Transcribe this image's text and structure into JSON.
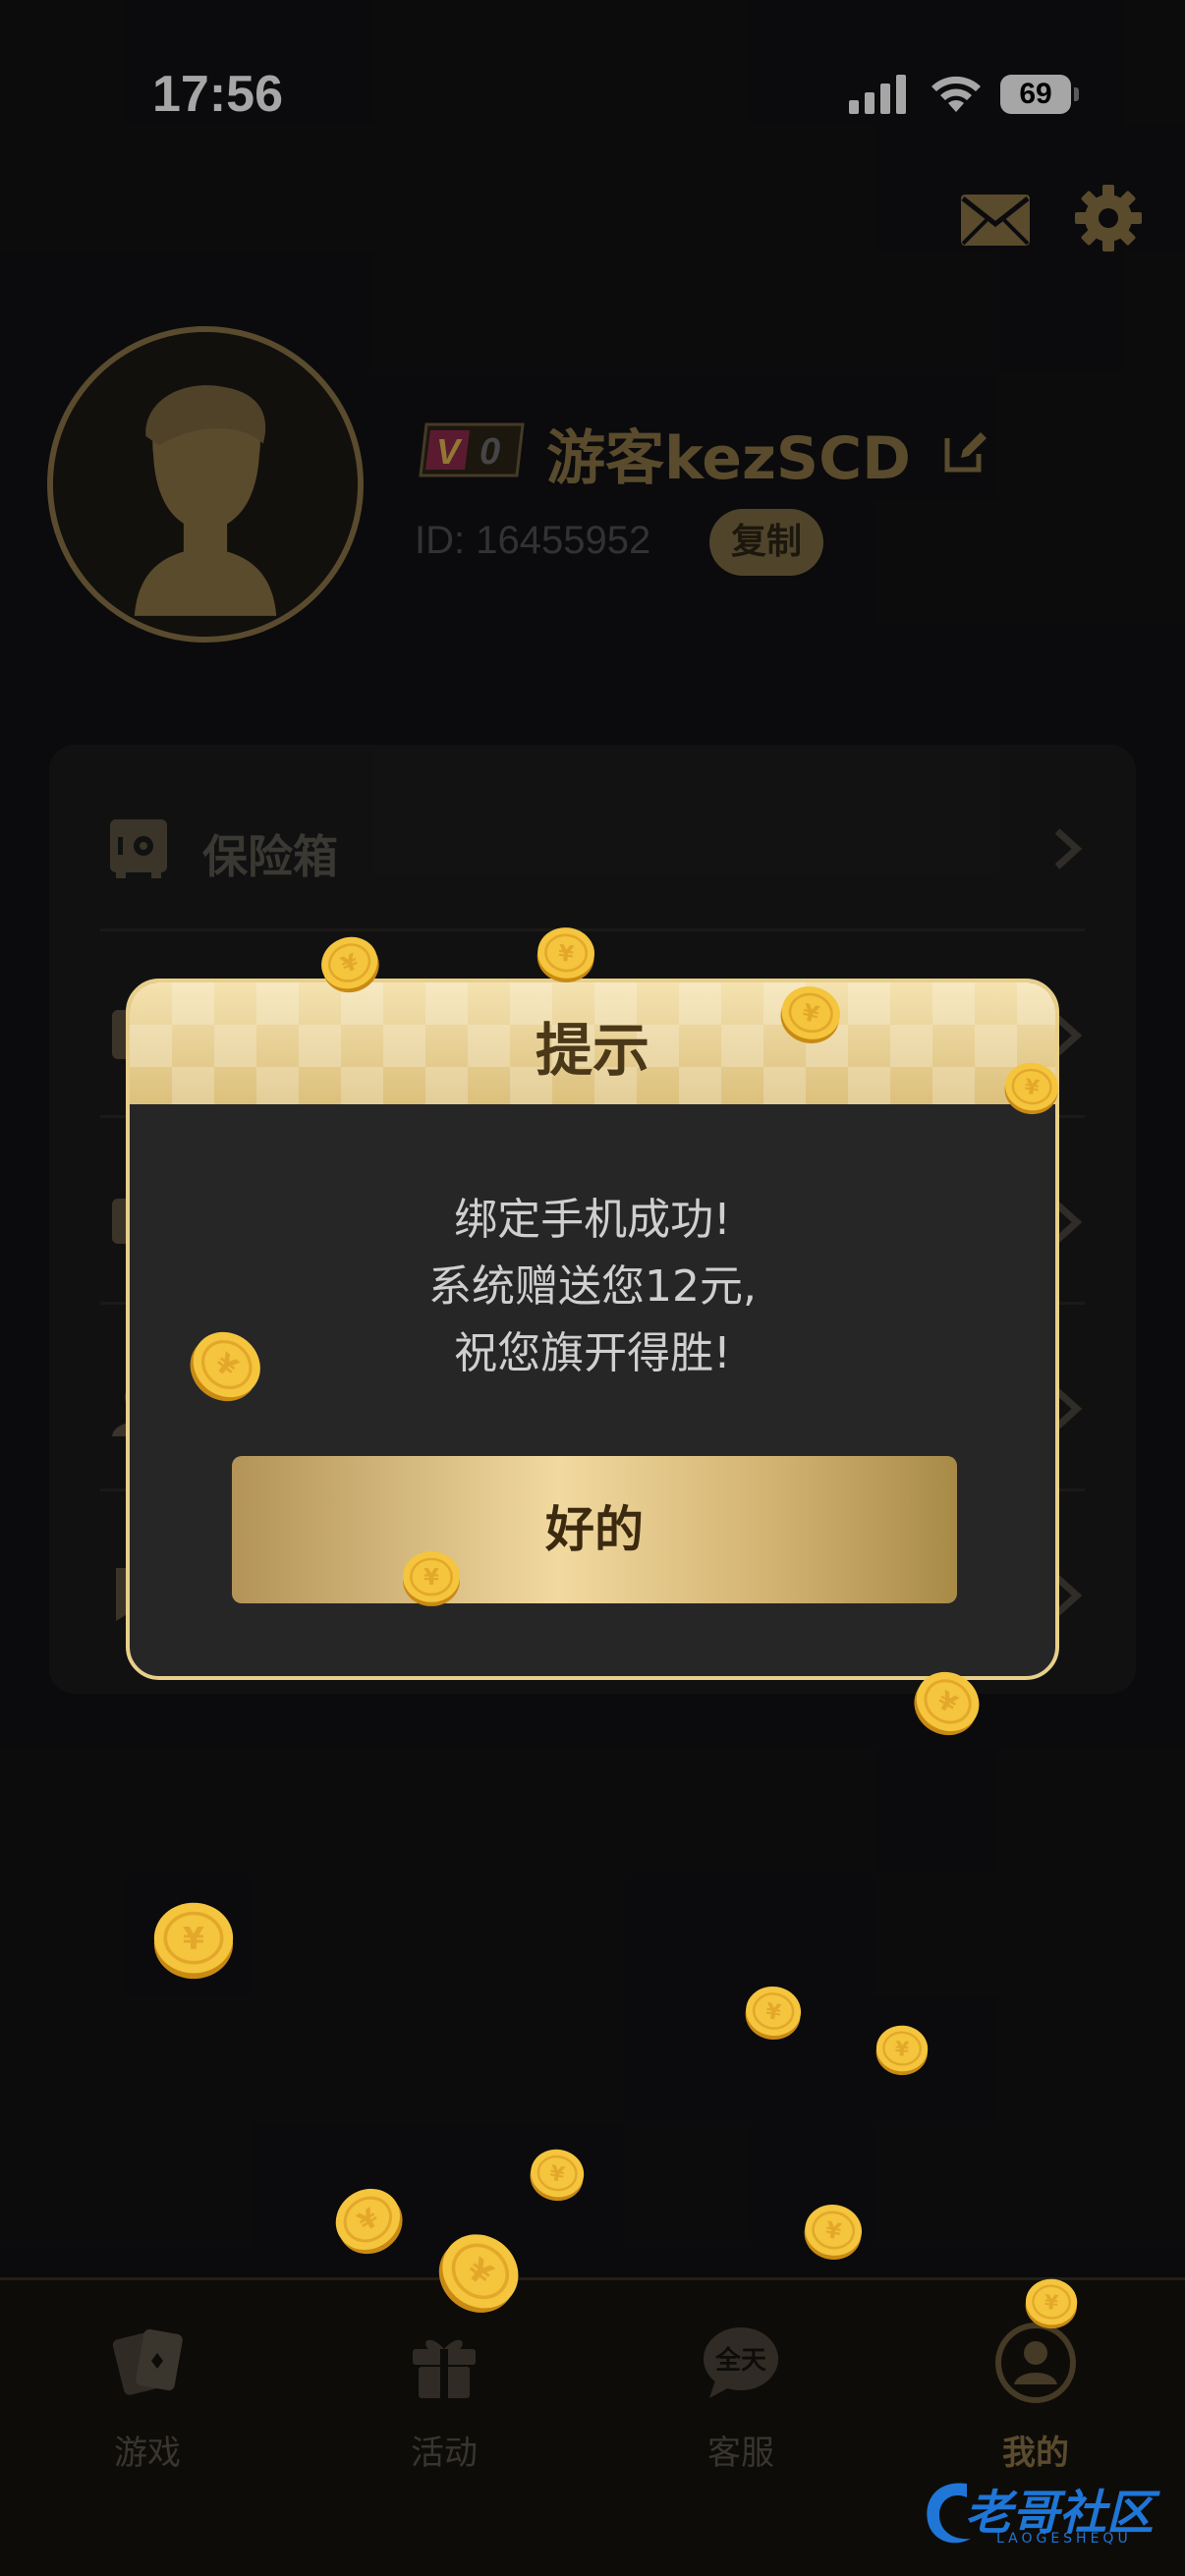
{
  "status_bar": {
    "time": "17:56",
    "battery": "69"
  },
  "header": {
    "mail_icon": "mail-icon",
    "settings_icon": "gear-icon"
  },
  "profile": {
    "vip_level": "0",
    "vip_letter": "V",
    "username": "游客kezSCD",
    "user_id": "ID: 16455952",
    "copy_label": "复制"
  },
  "menu": {
    "items": [
      {
        "label": "保险箱",
        "icon": "safe-icon"
      },
      {
        "label": "",
        "icon": "list-icon"
      },
      {
        "label": "",
        "icon": "id-card-icon"
      },
      {
        "label": "",
        "icon": "user-icon"
      },
      {
        "label": "",
        "icon": "bookmark-icon"
      }
    ]
  },
  "modal": {
    "title": "提示",
    "message_lines": [
      "绑定手机成功!",
      "系统赠送您12元,",
      "祝您旗开得胜!"
    ],
    "ok_label": "好的"
  },
  "tab_bar": {
    "tabs": [
      {
        "label": "游戏",
        "icon": "cards-icon",
        "active": false
      },
      {
        "label": "活动",
        "icon": "gift-icon",
        "active": false
      },
      {
        "label": "客服",
        "icon": "chat-icon",
        "icon_text": "全天",
        "active": false
      },
      {
        "label": "我的",
        "icon": "profile-icon",
        "active": true
      }
    ]
  },
  "watermark": {
    "text": "老哥社区",
    "sub": "LAOGESHEQU"
  },
  "colors": {
    "gold": "#8a7446",
    "gold_light": "#e8cf8a",
    "coin": "#f2c23a",
    "background": "#121214"
  }
}
